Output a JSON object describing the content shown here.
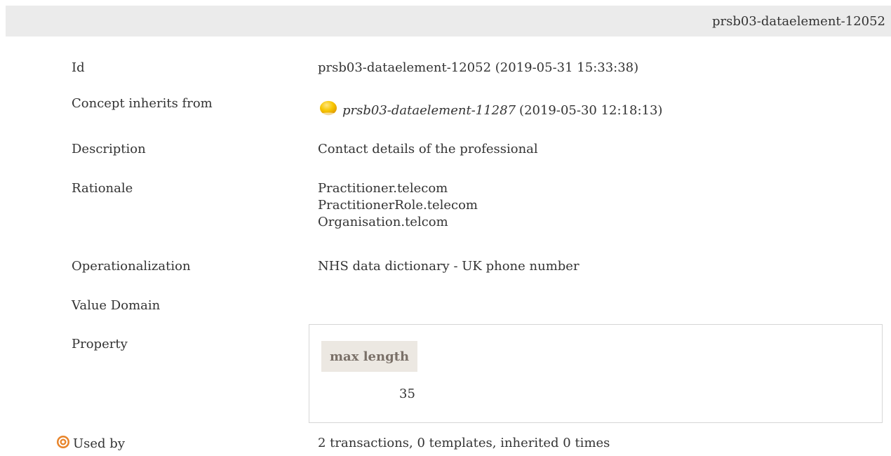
{
  "header": {
    "title": "prsb03-dataelement-12052"
  },
  "fields": {
    "id": {
      "label": "Id",
      "value": "prsb03-dataelement-12052 (2019-05-31 15:33:38)"
    },
    "concept_inherits": {
      "label": "Concept inherits from",
      "link_text": "prsb03-dataelement-11287",
      "date_text": "(2019-05-30 12:18:13)",
      "icon": "status-ball-icon",
      "icon_color": "#f5c000"
    },
    "description": {
      "label": "Description",
      "value": "Contact details of the professional"
    },
    "rationale": {
      "label": "Rationale",
      "lines": [
        "Practitioner.telecom",
        "PractitionerRole.telecom",
        "Organisation.telcom"
      ]
    },
    "operationalization": {
      "label": "Operationalization",
      "value": "NHS data dictionary - UK phone number"
    },
    "value_domain": {
      "label": "Value Domain"
    },
    "property": {
      "label": "Property",
      "column_header": "max length",
      "column_value": "35"
    },
    "used_by": {
      "label": "Used by",
      "icon": "target-icon",
      "icon_color": "#e8842a",
      "value": "2 transactions, 0 templates, inherited 0 times"
    }
  }
}
